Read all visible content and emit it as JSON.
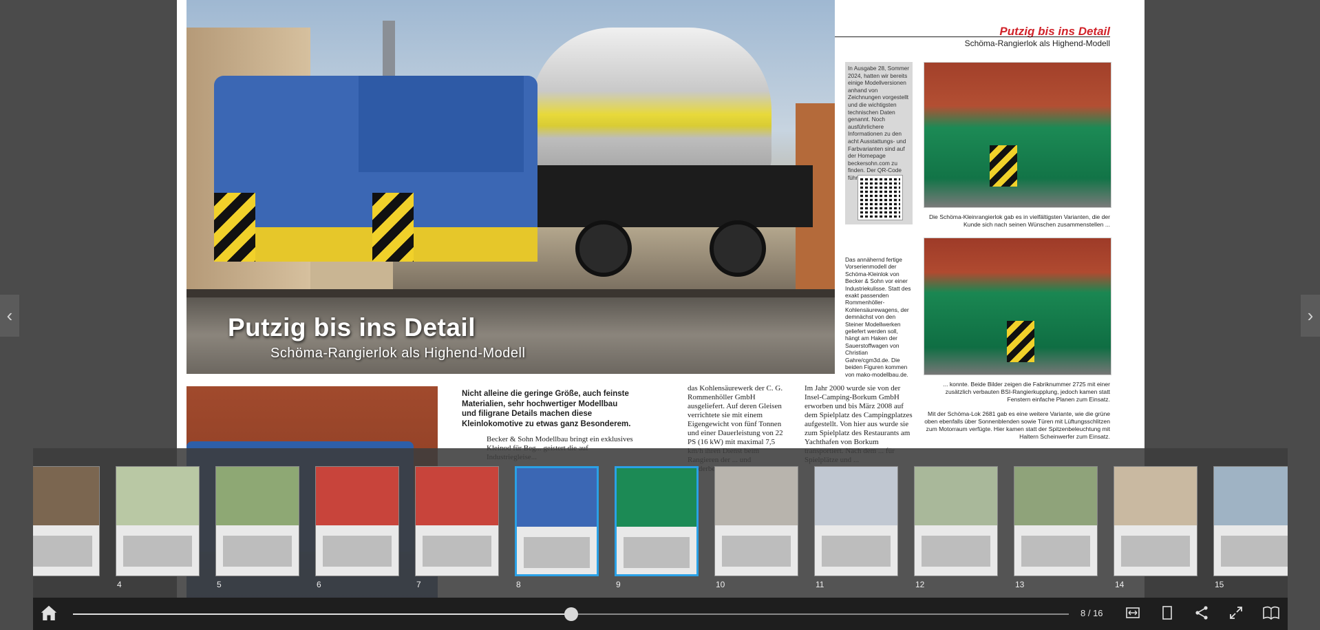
{
  "magazine": {
    "hero_title": "Putzig bis ins Detail",
    "hero_subtitle": "Schöma-Rangierlok als Highend-Modell",
    "intro": "Nicht alleine die geringe Größe, auch feinste Materialien, sehr hochwertiger Modellbau und filigrane Details machen diese Kleinlokomotive zu etwas ganz Besonderem.",
    "body_col1": "Becker & Sohn Modellbau bringt ein exklusives Kleinod für Beg... geistert die auf Industriegleise...",
    "body_col2": "das Kohlensäurewerk der C. G. Rommenhöller GmbH ausgeliefert. Auf deren Gleisen verrichtete sie mit einem Eigengewicht von fünf Tonnen und einer Dauerleistung von 22 PS (16 kW) mit maximal 7,5 km/h ihren Dienst beim Rangieren der ... und wiederbeladenen Koh...",
    "body_col3": "Im Jahr 2000 wurde sie von der Insel-Camping-Borkum GmbH erworben und bis März 2008 auf dem Spielplatz des Campingplatzes aufgestellt. Von hier aus wurde sie zum Spielplatz des Restaurants am Yachthafen von Borkum transportiert. Nach dem ... für Spielplätze und ...",
    "right_title": "Putzig bis ins Detail",
    "right_subtitle": "Schöma-Rangierlok als Highend-Modell",
    "info_box": "In Ausgabe 28, Sommer 2024, hatten wir bereits einige Modellversionen anhand von Zeichnungen vorgestellt und die wichtigsten technischen Daten genannt. Noch ausführlichere Informationen zu den acht Ausstattungs- und Farbvarianten sind auf der Homepage beckersohn.com zu finden. Der QR-Code führt direkt dort hin.",
    "caption_green1": "Die Schöma-Kleinrangierlok gab es in vielfältigsten Varianten, die der Kunde sich nach seinen Wünschen zusammenstellen ...",
    "caption_left": "Das annähernd fertige Vorserienmodell der Schöma-Kleinlok von Becker & Sohn vor einer Industriekulisse. Statt des exakt passenden Rommenhöller-Kohlensäurewagens, der demnächst von den Steiner Modellwerken geliefert werden soll, hängt am Haken der Sauerstoffwagen von Christian Gahre/cgm3d.de. Die beiden Figuren kommen von mako-modellbau.de.",
    "caption_green2": "... konnte. Beide Bilder zeigen die Fabriknummer 2725 mit einer zusätzlich verbauten BSI-Rangierkupplung, jedoch kamen statt Fenstern einfache Planen zum Einsatz.",
    "caption_blue": "Mit der Schöma-Lok 2681 gab es eine weitere Variante, wie die grüne oben ebenfalls über Sonnenblenden sowie Türen mit Lüftungsschlitzen zum Motorraum verfügte. Hier kamen statt der Spitzenbeleuchtung mit Haltern Scheinwerfer zum Einsatz."
  },
  "thumbnails": [
    {
      "label": "",
      "tone": "#7b6650"
    },
    {
      "label": "4",
      "tone": "#b9c8a4"
    },
    {
      "label": "5",
      "tone": "#8ea874"
    },
    {
      "label": "6",
      "tone": "#c8443b"
    },
    {
      "label": "7",
      "tone": "#c8443b"
    },
    {
      "label": "8",
      "tone": "#3b67b4"
    },
    {
      "label": "9",
      "tone": "#1c8a55"
    },
    {
      "label": "10",
      "tone": "#b8b4ad"
    },
    {
      "label": "11",
      "tone": "#c1c8d2"
    },
    {
      "label": "12",
      "tone": "#a9b89a"
    },
    {
      "label": "13",
      "tone": "#8fa37a"
    },
    {
      "label": "14",
      "tone": "#c9b9a1"
    },
    {
      "label": "15",
      "tone": "#9fb3c4"
    }
  ],
  "toolbar": {
    "page_counter": "8 / 16",
    "progress": 0.5
  },
  "colors": {
    "accent": "#2aa1e6",
    "title_red": "#d1232a",
    "toolbar_bg": "#1e1e1e"
  }
}
